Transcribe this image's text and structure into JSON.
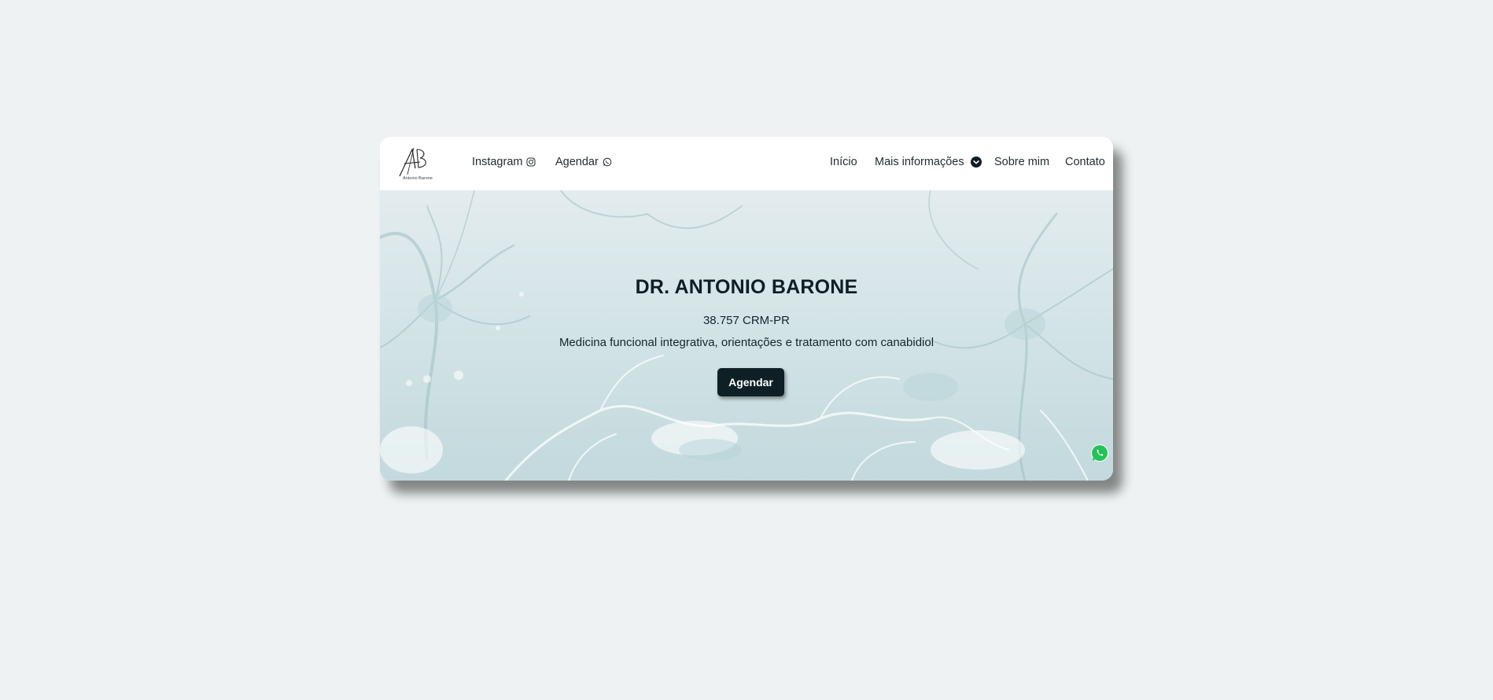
{
  "navbar": {
    "logo_icon": "antonio-barone-signature-logo",
    "logo_text": "Antonio Barone",
    "links_left": [
      {
        "label": "Instagram",
        "icon": "instagram-icon"
      },
      {
        "label": "Agendar",
        "icon": "whatsapp-icon"
      }
    ],
    "links_right": [
      {
        "label": "Início"
      },
      {
        "label": "Mais informações",
        "icon": "chevron-down-circle-icon"
      },
      {
        "label": "Sobre mim"
      },
      {
        "label": "Contato"
      }
    ]
  },
  "hero": {
    "title": "DR. ANTONIO BARONE",
    "crm": "38.757 CRM-PR",
    "description": "Medicina funcional integrativa, orientações e tratamento com canabidiol",
    "cta_label": "Agendar",
    "background": "neurons-illustration"
  },
  "floating": {
    "whatsapp_icon": "whatsapp-icon"
  },
  "colors": {
    "page_background": "#eef2f2",
    "nav_text": "#1f2b2f",
    "button_background": "#0e2026",
    "whatsapp_green": "#25c25a"
  }
}
